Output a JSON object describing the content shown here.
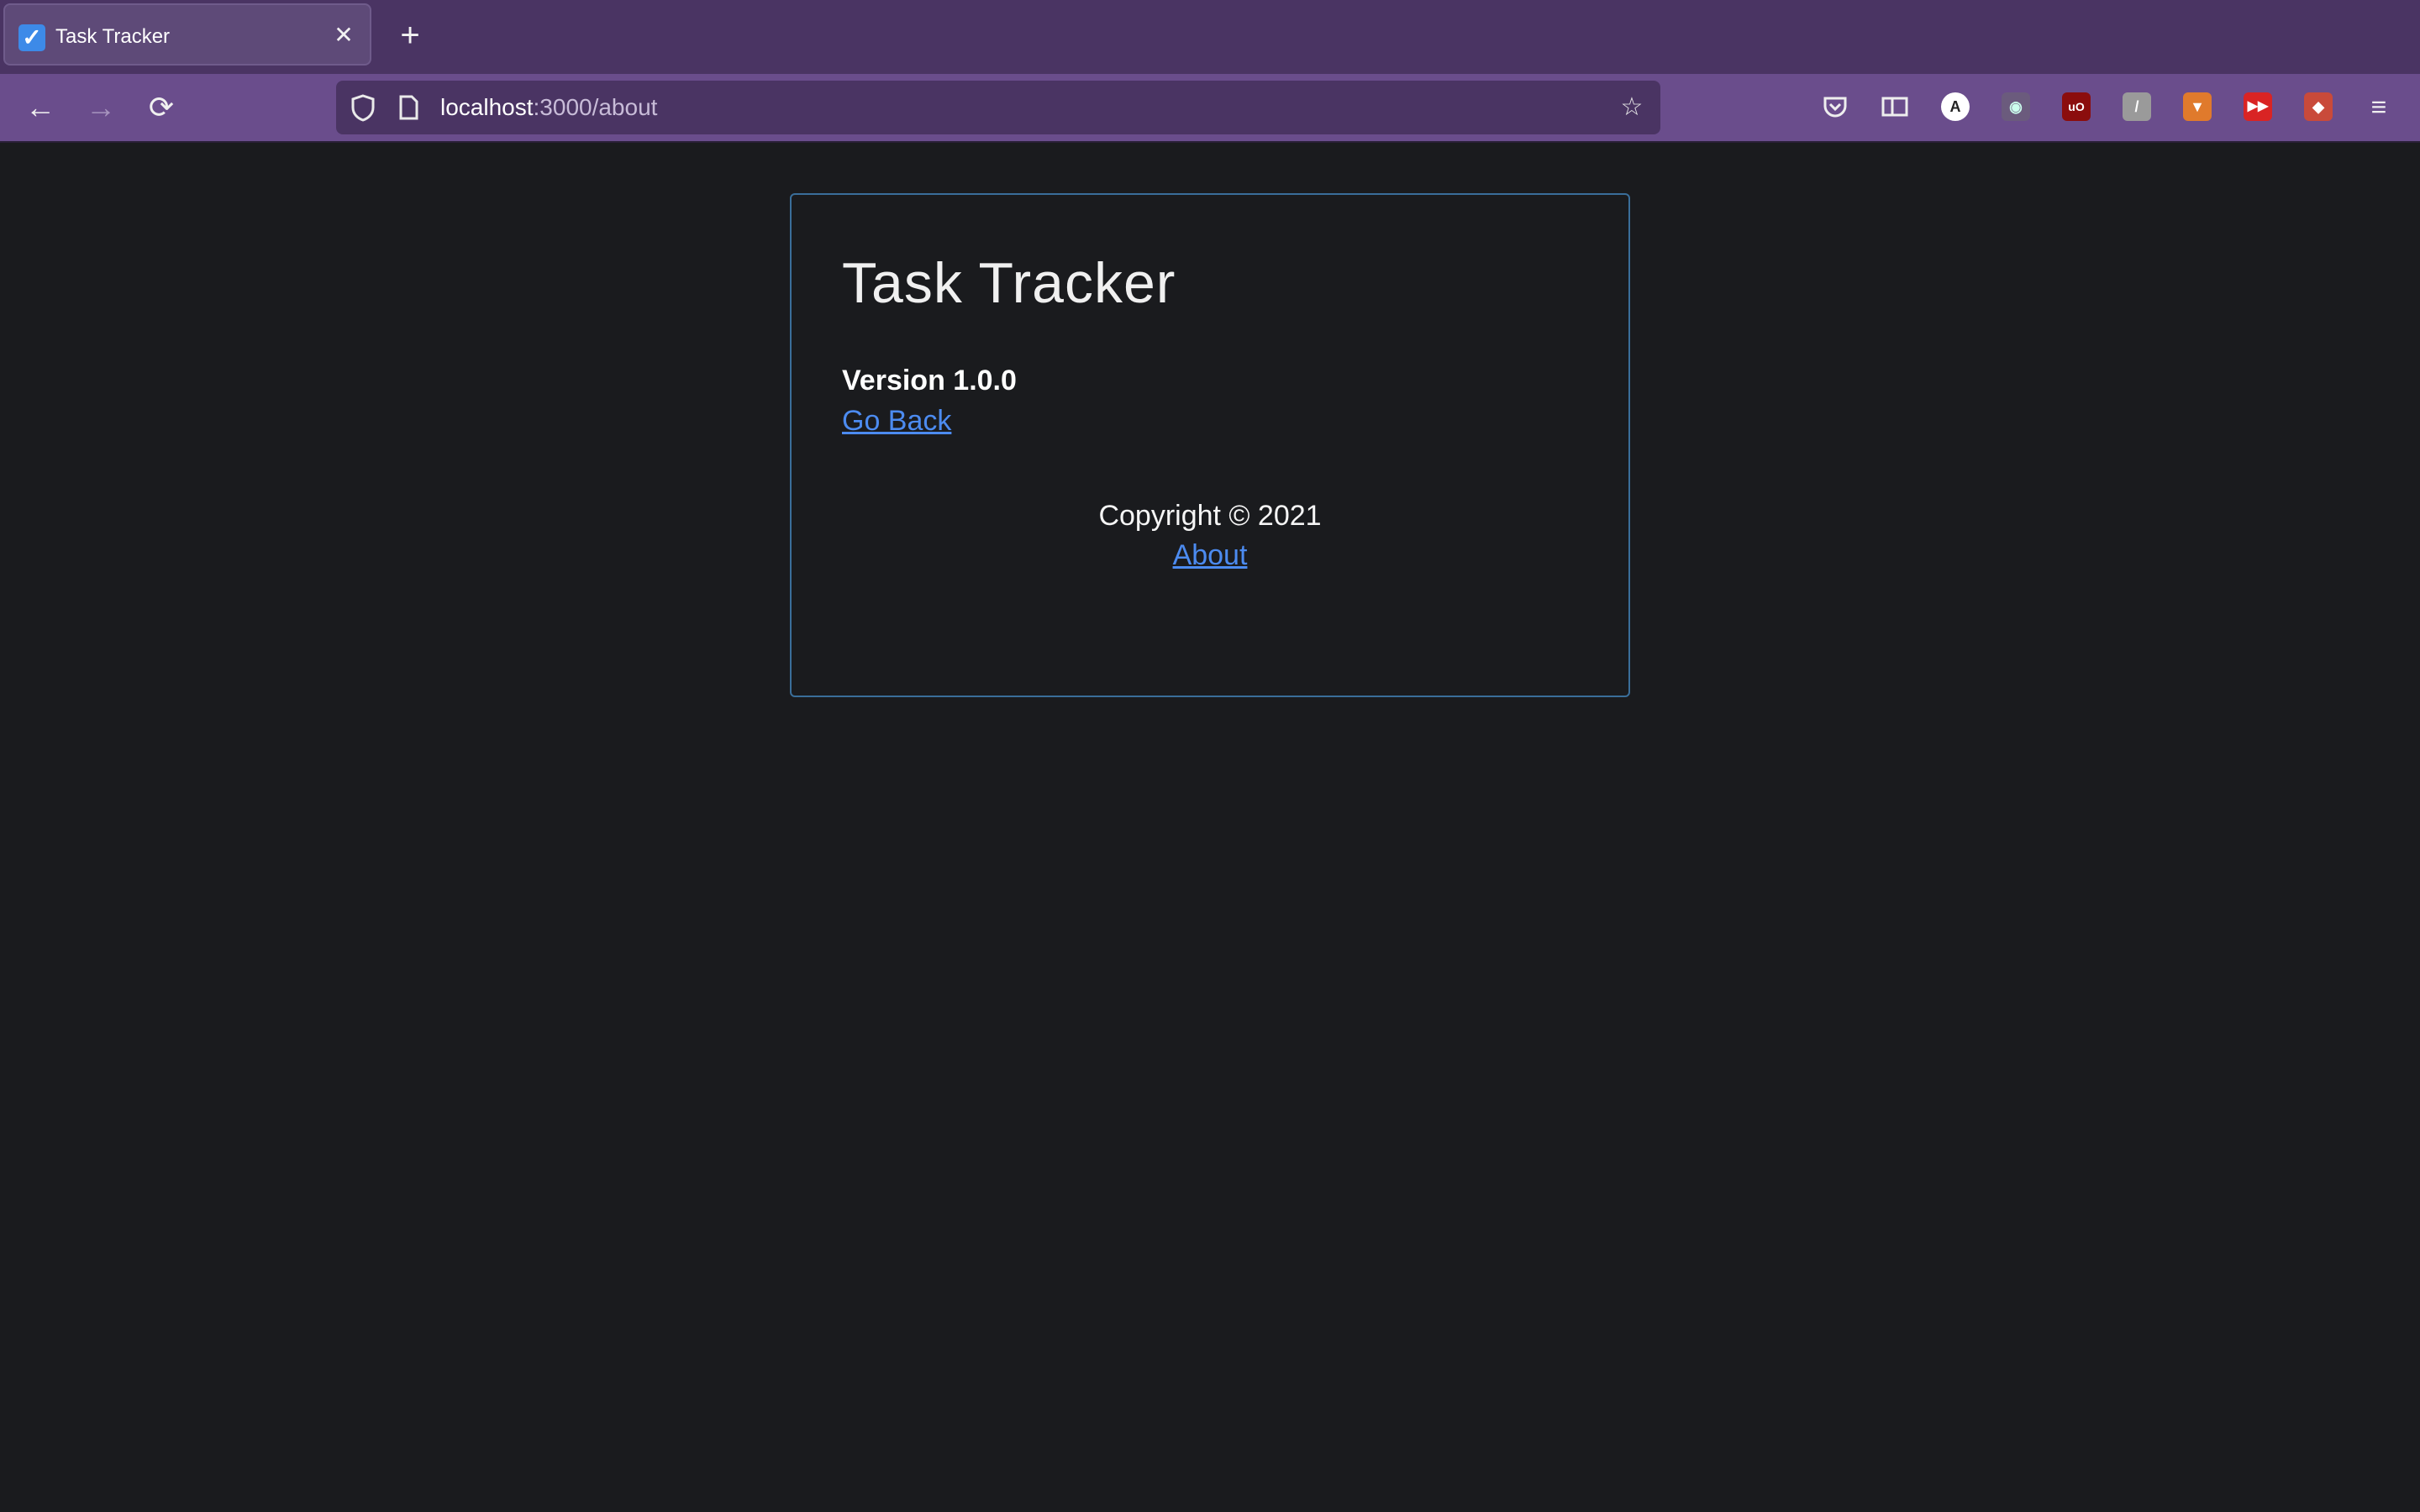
{
  "browser": {
    "tab": {
      "title": "Task Tracker",
      "favicon": "checkbox-icon"
    },
    "url": {
      "host": "localhost",
      "rest": ":3000/about"
    },
    "extensions": [
      "pocket-icon",
      "reader-view-icon",
      "account-icon",
      "incognito-icon",
      "ublock-icon",
      "slash-extension-icon",
      "metamask-icon",
      "youtube-extension-icon",
      "red-panda-extension-icon"
    ]
  },
  "page": {
    "title": "Task Tracker",
    "version": "Version 1.0.0",
    "go_back": "Go Back",
    "copyright": "Copyright © 2021",
    "about": "About"
  },
  "colors": {
    "accent": "#4c8bf0",
    "card_border": "#3a6e9a",
    "background": "#1a1b1e"
  }
}
